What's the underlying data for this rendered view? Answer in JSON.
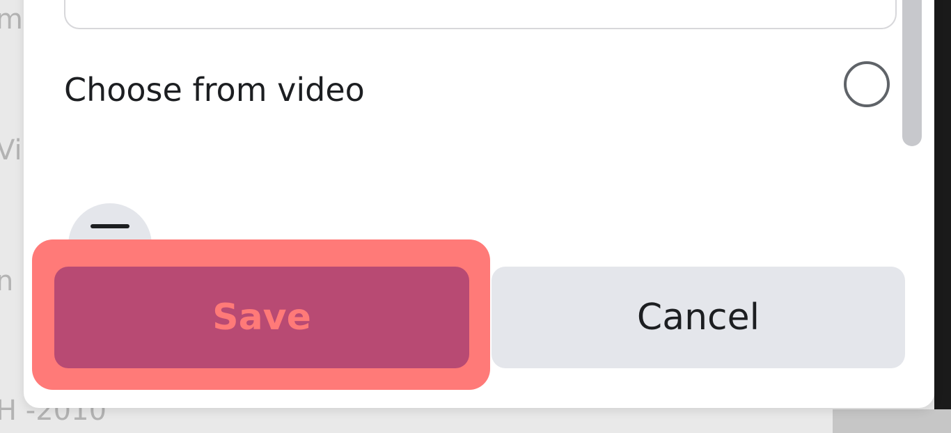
{
  "background": {
    "fragments": [
      "m",
      "Vi",
      "n",
      "H -2010"
    ]
  },
  "dialog": {
    "text_field_value": "",
    "option": {
      "label": "Choose from video",
      "selected": false
    }
  },
  "buttons": {
    "save_label": "Save",
    "cancel_label": "Cancel"
  },
  "colors": {
    "highlight": "#ff7a78",
    "save_bg": "#b84a73",
    "cancel_bg": "#e4e6eb"
  }
}
